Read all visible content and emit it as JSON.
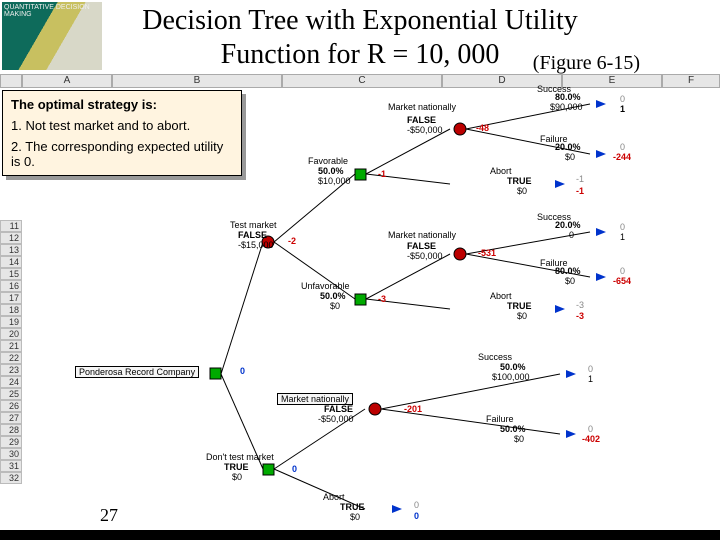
{
  "title_line1": "Decision Tree with Exponential Utility",
  "title_line2": "Function for R = 10, 000",
  "figure_label": "(Figure 6-15)",
  "book_brand": "QUANTITATIVE DECISION MAKING",
  "cols": {
    "a": "A",
    "b": "B",
    "c": "C",
    "d": "D",
    "e": "E",
    "f": "F"
  },
  "callout": {
    "header": "The optimal strategy is:",
    "item1": "1.  Not test market and to abort.",
    "item2": "2.  The corresponding expected utility is 0."
  },
  "tree": {
    "root": {
      "box": "Ponderosa Record Company",
      "value": "0"
    },
    "decision1_a": {
      "label": "Test market",
      "status": "FALSE",
      "cost": "-$15,000",
      "value": "-2"
    },
    "decision1_b": {
      "label": "Don't test market",
      "status": "TRUE",
      "cost": "$0",
      "value": "0"
    },
    "fav": {
      "label": "Favorable",
      "prob": "50.0%",
      "cost": "$10,000",
      "value": "-1"
    },
    "unfav": {
      "label": "Unfavorable",
      "prob": "50.0%",
      "cost": "$0",
      "value": "-3"
    },
    "fav_market": {
      "label": "Market nationally",
      "status": "FALSE",
      "cost": "-$50,000",
      "value": "-48"
    },
    "fav_abort": {
      "label": "Abort",
      "status": "TRUE",
      "cost": "$0",
      "value": "-1"
    },
    "unfav_market": {
      "label": "Market nationally",
      "status": "FALSE",
      "cost": "-$50,000",
      "value": "-531"
    },
    "unfav_abort": {
      "label": "Abort",
      "status": "TRUE",
      "cost": "$0",
      "value": "-3"
    },
    "fav_success": {
      "label": "Success",
      "prob": "80.0%",
      "cost": "$90,000",
      "pay": "0",
      "val": "1"
    },
    "fav_failure": {
      "label": "Failure",
      "prob": "20.0%",
      "cost": "$0",
      "pay": "0",
      "val": "-244"
    },
    "unfav_success": {
      "label": "Success",
      "prob": "20.0%",
      "cost": "0",
      "pay": "0",
      "val": "1"
    },
    "unfav_failure": {
      "label": "Failure",
      "prob": "80.0%",
      "cost": "$0",
      "pay": "0",
      "val": "-654"
    },
    "dtm_market": {
      "label": "Market nationally",
      "status": "FALSE",
      "cost": "-$50,000",
      "value": "-201"
    },
    "dtm_abort": {
      "label": "Abort",
      "status": "TRUE",
      "cost": "$0",
      "value": "0",
      "pay": "0"
    },
    "dtm_success": {
      "label": "Success",
      "prob": "50.0%",
      "cost": "$100,000",
      "pay": "0",
      "val": "1"
    },
    "dtm_failure": {
      "label": "Failure",
      "prob": "50.0%",
      "cost": "$0",
      "pay": "0",
      "val": "-402"
    }
  },
  "page_num": "27",
  "rows": [
    "11",
    "12",
    "13",
    "14",
    "15",
    "16",
    "17",
    "18",
    "19",
    "20",
    "21",
    "22",
    "23",
    "24",
    "25",
    "26",
    "27",
    "28",
    "29",
    "30",
    "31",
    "32"
  ]
}
